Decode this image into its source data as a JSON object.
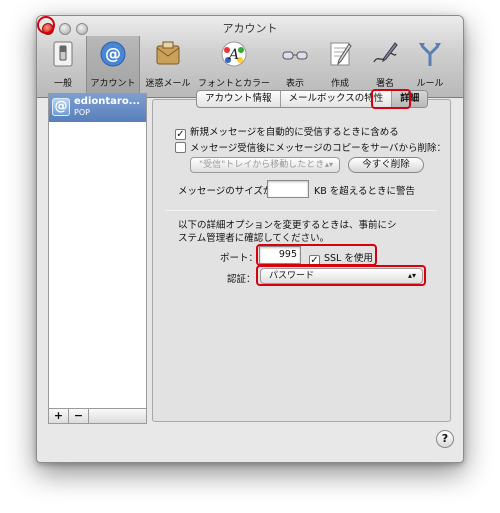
{
  "window": {
    "title": "アカウント"
  },
  "toolbar": {
    "items": [
      {
        "label": "一般"
      },
      {
        "label": "アカウント"
      },
      {
        "label": "迷惑メール"
      },
      {
        "label": "フォントとカラー"
      },
      {
        "label": "表示"
      },
      {
        "label": "作成"
      },
      {
        "label": "署名"
      },
      {
        "label": "ルール"
      }
    ]
  },
  "accounts": {
    "items": [
      {
        "name": "ediontaro...",
        "type": "POP"
      }
    ],
    "add_label": "+",
    "remove_label": "−"
  },
  "tabs": [
    {
      "label": "アカウント情報"
    },
    {
      "label": "メールボックスの特性"
    },
    {
      "label": "詳細"
    }
  ],
  "advanced": {
    "include_auto": {
      "label": "新規メッセージを自動的に受信するときに含める",
      "checked": true
    },
    "delete_copy": {
      "label": "メッセージ受信後にメッセージのコピーをサーバから削除：",
      "checked": false
    },
    "delete_when": "\"受信\"トレイから移動したとき",
    "delete_now_button": "今すぐ削除",
    "size_label": "メッセージのサイズが",
    "size_value": "",
    "size_suffix": "KB を超えるときに警告",
    "admin_note": "以下の詳細オプションを変更するときは、事前にシステム管理者に確認してください。",
    "port_label": "ポート：",
    "port_value": "995",
    "ssl": {
      "label": "SSL を使用",
      "checked": true
    },
    "auth_label": "認証：",
    "auth_value": "パスワード"
  },
  "help_label": "?",
  "colors": {
    "highlight": "#d9000e",
    "selection": "#6a8fc7"
  }
}
